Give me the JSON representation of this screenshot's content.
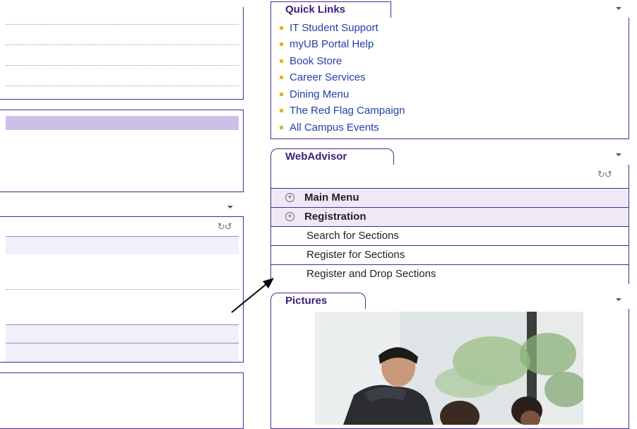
{
  "quick_links": {
    "tab_label": "Quick Links",
    "items": [
      {
        "label": "IT Student Support"
      },
      {
        "label": "myUB Portal Help"
      },
      {
        "label": "Book Store"
      },
      {
        "label": "Career Services"
      },
      {
        "label": "Dining Menu"
      },
      {
        "label": "The Red Flag Campaign"
      },
      {
        "label": "All Campus Events"
      }
    ]
  },
  "web_advisor": {
    "tab_label": "WebAdvisor",
    "main_menu_label": "Main Menu",
    "registration_label": "Registration",
    "items": [
      {
        "label": "Search for Sections"
      },
      {
        "label": "Register for Sections"
      },
      {
        "label": "Register and Drop Sections"
      }
    ]
  },
  "pictures": {
    "tab_label": "Pictures"
  },
  "icons": {
    "expand": "plus-circle-icon",
    "refresh": "refresh-icon",
    "dropdown": "caret-down-icon"
  },
  "colors": {
    "border": "#4b2a87",
    "link": "#233fa8",
    "bullet": "#e1b520",
    "highlight": "#cdbfe8",
    "row_bg": "#efe9f7"
  }
}
